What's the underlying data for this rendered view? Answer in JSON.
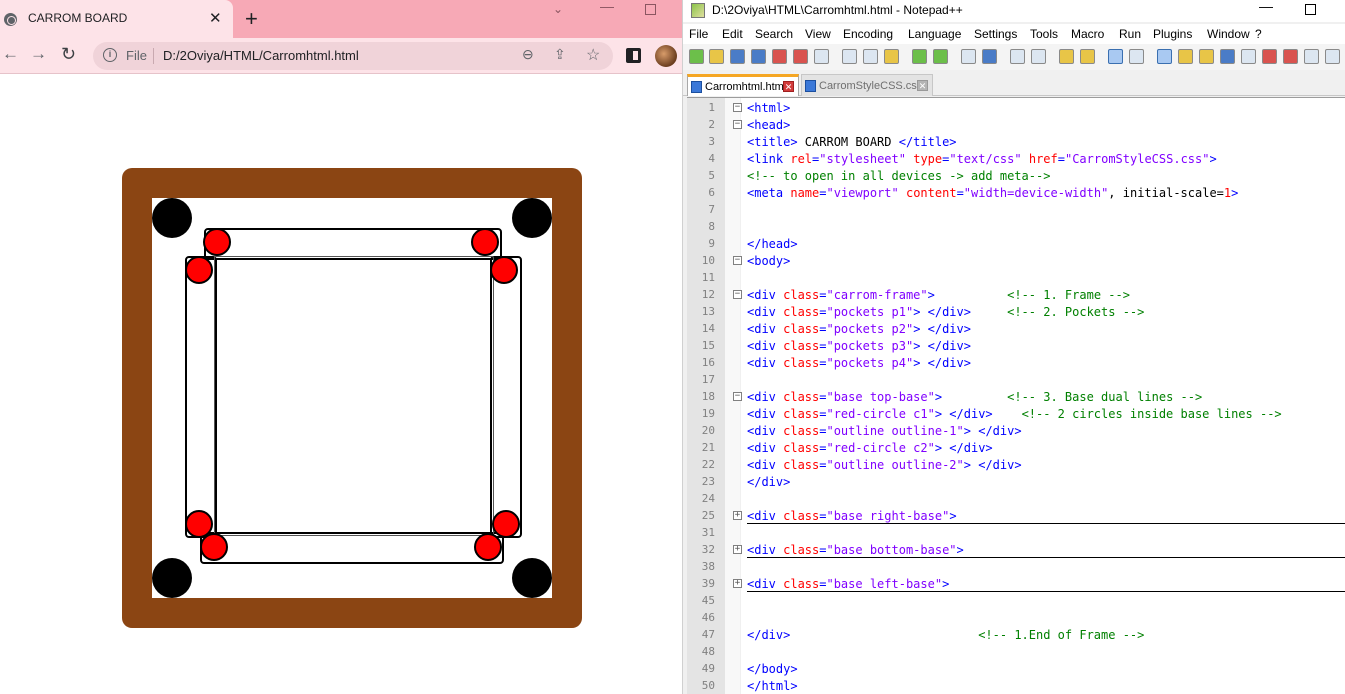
{
  "browser": {
    "tab_title": "CARROM BOARD",
    "tab_close": "✕",
    "new_tab": "+",
    "scheme": "File",
    "url": "D:/2Oviya/HTML/Carromhtml.html",
    "back": "←",
    "forward": "→",
    "reload": "↻",
    "zoom": "⊖",
    "share": "⇪",
    "star": "☆",
    "minimize": "—",
    "chevron": "⌄"
  },
  "notepad": {
    "window_title": "D:\\2Oviya\\HTML\\Carromhtml.html - Notepad++",
    "minimize": "—",
    "menu": [
      "File",
      "Edit",
      "Search",
      "View",
      "Encoding",
      "Language",
      "Settings",
      "Tools",
      "Macro",
      "Run",
      "Plugins",
      "Window",
      "?"
    ],
    "tabs": [
      {
        "label": "Carromhtml.html",
        "active": true
      },
      {
        "label": "CarromStyleCSS.css",
        "active": false
      }
    ],
    "tab_close": "✕",
    "lines": [
      {
        "n": "1",
        "fold": "−",
        "parts": [
          [
            "t",
            "<html>"
          ]
        ]
      },
      {
        "n": "2",
        "fold": "−",
        "parts": [
          [
            "t",
            "<head>"
          ]
        ]
      },
      {
        "n": "3",
        "fold": "",
        "parts": [
          [
            "t",
            "<title>"
          ],
          [
            "k",
            " CARROM BOARD "
          ],
          [
            "t",
            "</title>"
          ]
        ]
      },
      {
        "n": "4",
        "fold": "",
        "parts": [
          [
            "t",
            "<link "
          ],
          [
            "a",
            "rel"
          ],
          [
            "t",
            "="
          ],
          [
            "v",
            "\"stylesheet\""
          ],
          [
            "t",
            " "
          ],
          [
            "a",
            "type"
          ],
          [
            "t",
            "="
          ],
          [
            "v",
            "\"text/css\""
          ],
          [
            "t",
            " "
          ],
          [
            "a",
            "href"
          ],
          [
            "t",
            "="
          ],
          [
            "v",
            "\"CarromStyleCSS.css\""
          ],
          [
            "t",
            ">"
          ]
        ]
      },
      {
        "n": "5",
        "fold": "",
        "parts": [
          [
            "c",
            "<!-- to open in all devices -> add meta-->"
          ]
        ]
      },
      {
        "n": "6",
        "fold": "",
        "parts": [
          [
            "t",
            "<meta "
          ],
          [
            "a",
            "name"
          ],
          [
            "t",
            "="
          ],
          [
            "v",
            "\"viewport\""
          ],
          [
            "t",
            " "
          ],
          [
            "a",
            "content"
          ],
          [
            "t",
            "="
          ],
          [
            "v",
            "\"width=device-width\""
          ],
          [
            "k",
            ", initial-scale="
          ],
          [
            "a",
            "1"
          ],
          [
            "t",
            ">"
          ]
        ]
      },
      {
        "n": "7",
        "fold": "",
        "parts": []
      },
      {
        "n": "8",
        "fold": "",
        "parts": []
      },
      {
        "n": "9",
        "fold": "",
        "parts": [
          [
            "t",
            "</head>"
          ]
        ]
      },
      {
        "n": "10",
        "fold": "−",
        "parts": [
          [
            "t",
            "<body>"
          ]
        ]
      },
      {
        "n": "11",
        "fold": "",
        "parts": []
      },
      {
        "n": "12",
        "fold": "−",
        "parts": [
          [
            "t",
            "<div "
          ],
          [
            "a",
            "class"
          ],
          [
            "t",
            "="
          ],
          [
            "v",
            "\"carrom-frame\""
          ],
          [
            "t",
            ">"
          ],
          [
            "k",
            "          "
          ],
          [
            "c",
            "<!-- 1. Frame -->"
          ]
        ]
      },
      {
        "n": "13",
        "fold": "",
        "parts": [
          [
            "t",
            "<div "
          ],
          [
            "a",
            "class"
          ],
          [
            "t",
            "="
          ],
          [
            "v",
            "\"pockets p1\""
          ],
          [
            "t",
            "> </div>"
          ],
          [
            "k",
            "     "
          ],
          [
            "c",
            "<!-- 2. Pockets -->"
          ]
        ]
      },
      {
        "n": "14",
        "fold": "",
        "parts": [
          [
            "t",
            "<div "
          ],
          [
            "a",
            "class"
          ],
          [
            "t",
            "="
          ],
          [
            "v",
            "\"pockets p2\""
          ],
          [
            "t",
            "> </div>"
          ]
        ]
      },
      {
        "n": "15",
        "fold": "",
        "parts": [
          [
            "t",
            "<div "
          ],
          [
            "a",
            "class"
          ],
          [
            "t",
            "="
          ],
          [
            "v",
            "\"pockets p3\""
          ],
          [
            "t",
            "> </div>"
          ]
        ]
      },
      {
        "n": "16",
        "fold": "",
        "parts": [
          [
            "t",
            "<div "
          ],
          [
            "a",
            "class"
          ],
          [
            "t",
            "="
          ],
          [
            "v",
            "\"pockets p4\""
          ],
          [
            "t",
            "> </div>"
          ]
        ]
      },
      {
        "n": "17",
        "fold": "",
        "parts": []
      },
      {
        "n": "18",
        "fold": "−",
        "parts": [
          [
            "t",
            "<div "
          ],
          [
            "a",
            "class"
          ],
          [
            "t",
            "="
          ],
          [
            "v",
            "\"base top-base\""
          ],
          [
            "t",
            ">"
          ],
          [
            "k",
            "         "
          ],
          [
            "c",
            "<!-- 3. Base dual lines -->"
          ]
        ]
      },
      {
        "n": "19",
        "fold": "",
        "parts": [
          [
            "t",
            "<div "
          ],
          [
            "a",
            "class"
          ],
          [
            "t",
            "="
          ],
          [
            "v",
            "\"red-circle c1\""
          ],
          [
            "t",
            "> </div>"
          ],
          [
            "k",
            "    "
          ],
          [
            "c",
            "<!-- 2 circles inside base lines -->"
          ]
        ]
      },
      {
        "n": "20",
        "fold": "",
        "parts": [
          [
            "t",
            "<div "
          ],
          [
            "a",
            "class"
          ],
          [
            "t",
            "="
          ],
          [
            "v",
            "\"outline outline-1\""
          ],
          [
            "t",
            "> </div>"
          ]
        ]
      },
      {
        "n": "21",
        "fold": "",
        "parts": [
          [
            "t",
            "<div "
          ],
          [
            "a",
            "class"
          ],
          [
            "t",
            "="
          ],
          [
            "v",
            "\"red-circle c2\""
          ],
          [
            "t",
            "> </div>"
          ]
        ]
      },
      {
        "n": "22",
        "fold": "",
        "parts": [
          [
            "t",
            "<div "
          ],
          [
            "a",
            "class"
          ],
          [
            "t",
            "="
          ],
          [
            "v",
            "\"outline outline-2\""
          ],
          [
            "t",
            "> </div>"
          ]
        ]
      },
      {
        "n": "23",
        "fold": "",
        "parts": [
          [
            "t",
            "</div>"
          ]
        ]
      },
      {
        "n": "24",
        "fold": "",
        "parts": []
      },
      {
        "n": "25",
        "fold": "+",
        "underline": true,
        "parts": [
          [
            "t",
            "<div "
          ],
          [
            "a",
            "class"
          ],
          [
            "t",
            "="
          ],
          [
            "v",
            "\"base right-base\""
          ],
          [
            "t",
            ">"
          ]
        ]
      },
      {
        "n": "31",
        "fold": "",
        "parts": []
      },
      {
        "n": "32",
        "fold": "+",
        "underline": true,
        "parts": [
          [
            "t",
            "<div "
          ],
          [
            "a",
            "class"
          ],
          [
            "t",
            "="
          ],
          [
            "v",
            "\"base bottom-base\""
          ],
          [
            "t",
            ">"
          ]
        ]
      },
      {
        "n": "38",
        "fold": "",
        "parts": []
      },
      {
        "n": "39",
        "fold": "+",
        "underline": true,
        "parts": [
          [
            "t",
            "<div "
          ],
          [
            "a",
            "class"
          ],
          [
            "t",
            "="
          ],
          [
            "v",
            "\"base left-base\""
          ],
          [
            "t",
            ">"
          ]
        ]
      },
      {
        "n": "45",
        "fold": "",
        "parts": []
      },
      {
        "n": "46",
        "fold": "",
        "parts": []
      },
      {
        "n": "47",
        "fold": "",
        "parts": [
          [
            "t",
            "</div>"
          ],
          [
            "k",
            "                          "
          ],
          [
            "c",
            "<!-- 1.End of Frame -->"
          ]
        ]
      },
      {
        "n": "48",
        "fold": "",
        "parts": []
      },
      {
        "n": "49",
        "fold": "",
        "parts": [
          [
            "t",
            "</body>"
          ]
        ]
      },
      {
        "n": "50",
        "fold": "",
        "parts": [
          [
            "t",
            "</html>"
          ]
        ]
      }
    ]
  },
  "colors": {
    "frame": "#8b4513",
    "pocket": "#000000",
    "red_circle": "#ff0000",
    "tag": "#0000ff",
    "attr": "#ff0000",
    "value": "#8000ff",
    "comment": "#008000"
  }
}
